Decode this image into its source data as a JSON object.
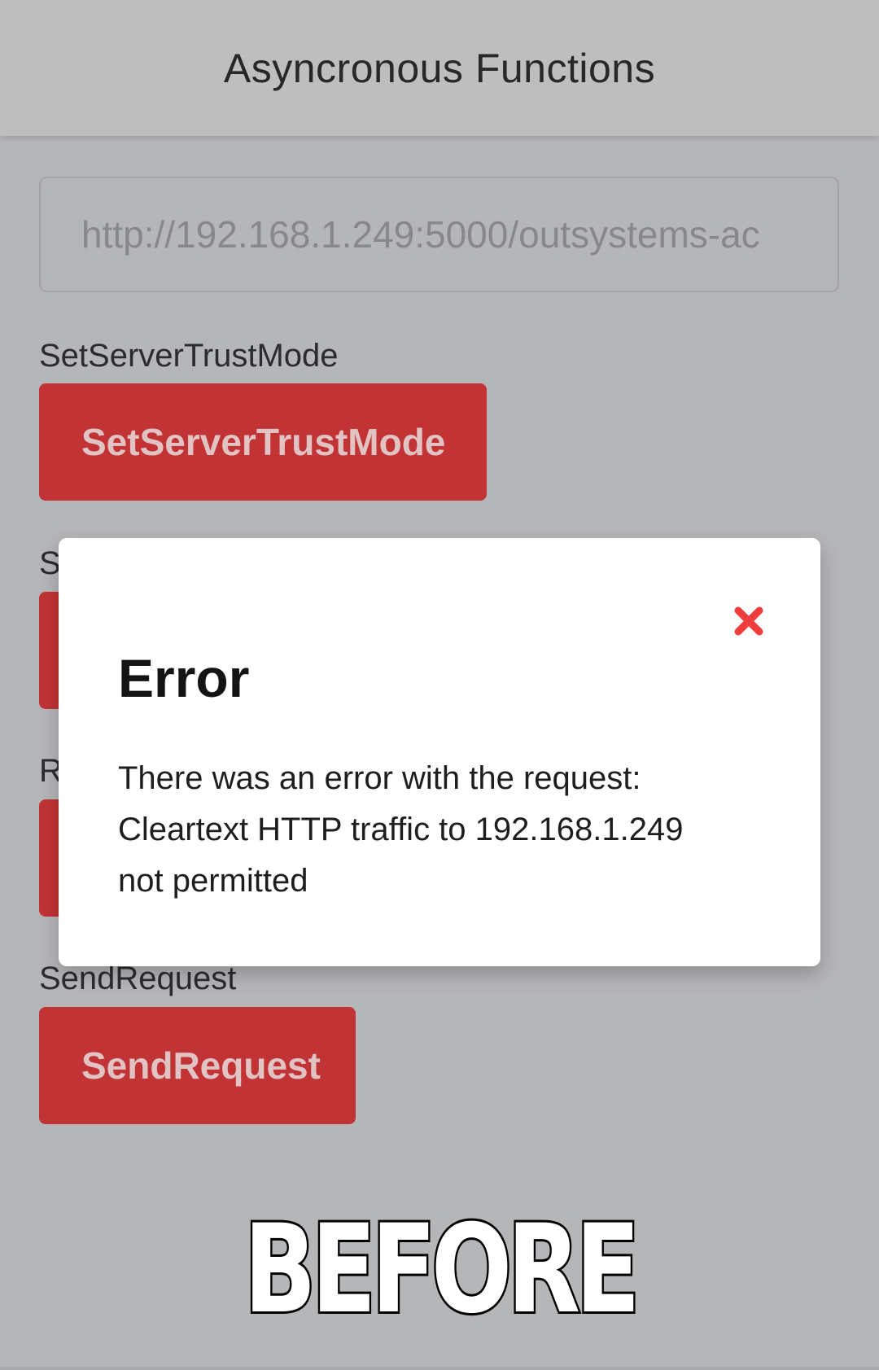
{
  "header": {
    "title": "Asyncronous Functions"
  },
  "url_input": {
    "placeholder": "http://192.168.1.249:5000/outsystems-ac"
  },
  "sections": [
    {
      "label": "SetServerTrustMode",
      "button": "SetServerTrustMode"
    },
    {
      "label": "S",
      "button": ""
    },
    {
      "label": "R",
      "button": ""
    },
    {
      "label": "SendRequest",
      "button": "SendRequest"
    }
  ],
  "modal": {
    "title": "Error",
    "message": "There was an error with the request: Cleartext HTTP traffic to 192.168.1.249 not permitted",
    "close_icon": "close-x-icon"
  },
  "caption": "BEFORE",
  "colors": {
    "button_red": "#c13335",
    "close_red": "#f03c3c",
    "backdrop": "#b5b6b8"
  }
}
